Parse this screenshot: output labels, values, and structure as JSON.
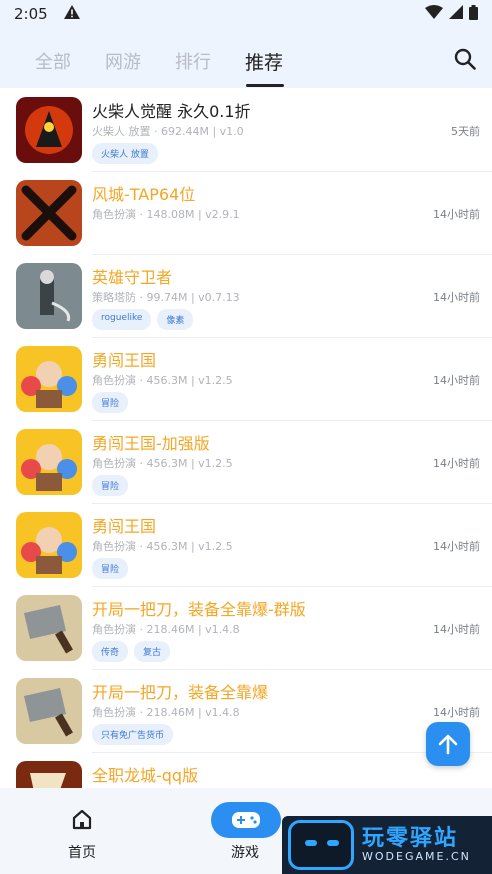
{
  "status": {
    "time": "2:05"
  },
  "tabs": [
    "全部",
    "网游",
    "排行",
    "推荐"
  ],
  "active_tab": "推荐",
  "games": [
    {
      "title": "火柴人觉醒 永久0.1折",
      "meta": "火柴人 放置 · 692.44M | v1.0",
      "time": "5天前",
      "tags": [
        "火柴人 放置"
      ],
      "title_style": "dark"
    },
    {
      "title": "风城-TAP64位",
      "meta": "角色扮演 · 148.08M | v2.9.1",
      "time": "14小时前",
      "tags": []
    },
    {
      "title": "英雄守卫者",
      "meta": "策略塔防 · 99.74M | v0.7.13",
      "time": "14小时前",
      "tags": [
        "roguelike",
        "像素"
      ]
    },
    {
      "title": "勇闯王国",
      "meta": "角色扮演 · 456.3M | v1.2.5",
      "time": "14小时前",
      "tags": [
        "冒险"
      ]
    },
    {
      "title": "勇闯王国-加强版",
      "meta": "角色扮演 · 456.3M | v1.2.5",
      "time": "14小时前",
      "tags": [
        "冒险"
      ]
    },
    {
      "title": "勇闯王国",
      "meta": "角色扮演 · 456.3M | v1.2.5",
      "time": "14小时前",
      "tags": [
        "冒险"
      ]
    },
    {
      "title": "开局一把刀，装备全靠爆-群版",
      "meta": "角色扮演 · 218.46M | v1.4.8",
      "time": "14小时前",
      "tags": [
        "传奇",
        "复古"
      ]
    },
    {
      "title": "开局一把刀，装备全靠爆",
      "meta": "角色扮演 · 218.46M | v1.4.8",
      "time": "14小时前",
      "tags": [
        "只有免广告货币"
      ]
    },
    {
      "title": "全职龙城-qq版",
      "meta": "",
      "time": "",
      "tags": []
    }
  ],
  "nav": {
    "home": "首页",
    "game": "游戏"
  },
  "watermark": {
    "text": "玩零驿站",
    "url": "WODEGAME.CN"
  },
  "colors": {
    "accent": "#2b8ff2",
    "title": "#f5a623",
    "header_bg": "#eef4fd"
  }
}
